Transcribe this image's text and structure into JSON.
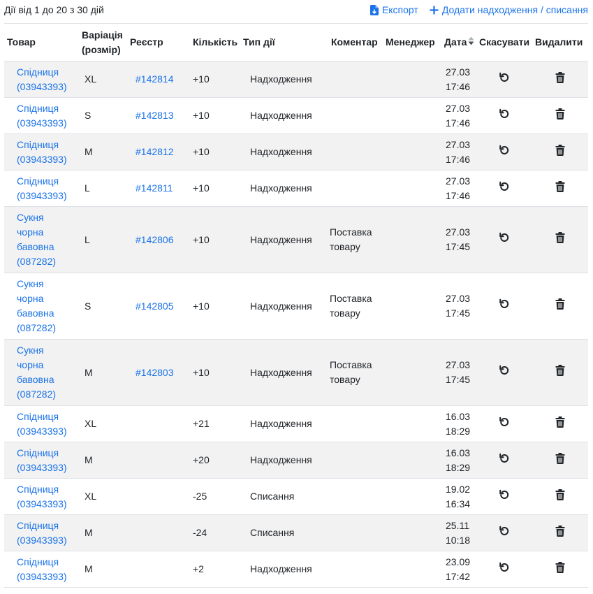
{
  "summary": "Дії від 1 до 20 з 30 дій",
  "toolbar": {
    "export_label": "Експорт",
    "add_label": "Додати надходження / списання"
  },
  "colors": {
    "link": "#1a73e8",
    "stripe": "#f2f2f2",
    "text": "#212529"
  },
  "headers": {
    "product": "Товар",
    "variation": "Варіація (розмір)",
    "registry": "Реєстр",
    "quantity": "Кількість",
    "action_type": "Тип дії",
    "comment": "Коментар",
    "manager": "Менеджер",
    "date": "Дата",
    "undo": "Скасувати",
    "delete": "Видалити"
  },
  "rows": [
    {
      "product_name": "Спідниця",
      "product_code": "(03943393)",
      "variation": "XL",
      "registry": "#142814",
      "quantity": "+10",
      "type": "Надходження",
      "comment": "",
      "manager": "",
      "date": "27.03",
      "time": "17:46"
    },
    {
      "product_name": "Спідниця",
      "product_code": "(03943393)",
      "variation": "S",
      "registry": "#142813",
      "quantity": "+10",
      "type": "Надходження",
      "comment": "",
      "manager": "",
      "date": "27.03",
      "time": "17:46"
    },
    {
      "product_name": "Спідниця",
      "product_code": "(03943393)",
      "variation": "M",
      "registry": "#142812",
      "quantity": "+10",
      "type": "Надходження",
      "comment": "",
      "manager": "",
      "date": "27.03",
      "time": "17:46"
    },
    {
      "product_name": "Спідниця",
      "product_code": "(03943393)",
      "variation": "L",
      "registry": "#142811",
      "quantity": "+10",
      "type": "Надходження",
      "comment": "",
      "manager": "",
      "date": "27.03",
      "time": "17:46"
    },
    {
      "product_name": "Сукня чорна бавовна",
      "product_code": "(087282)",
      "variation": "L",
      "registry": "#142806",
      "quantity": "+10",
      "type": "Надходження",
      "comment": "Поставка товару",
      "manager": "",
      "date": "27.03",
      "time": "17:45"
    },
    {
      "product_name": "Сукня чорна бавовна",
      "product_code": "(087282)",
      "variation": "S",
      "registry": "#142805",
      "quantity": "+10",
      "type": "Надходження",
      "comment": "Поставка товару",
      "manager": "",
      "date": "27.03",
      "time": "17:45"
    },
    {
      "product_name": "Сукня чорна бавовна",
      "product_code": "(087282)",
      "variation": "M",
      "registry": "#142803",
      "quantity": "+10",
      "type": "Надходження",
      "comment": "Поставка товару",
      "manager": "",
      "date": "27.03",
      "time": "17:45"
    },
    {
      "product_name": "Спідниця",
      "product_code": "(03943393)",
      "variation": "XL",
      "registry": "",
      "quantity": "+21",
      "type": "Надходження",
      "comment": "",
      "manager": "",
      "date": "16.03",
      "time": "18:29"
    },
    {
      "product_name": "Спідниця",
      "product_code": "(03943393)",
      "variation": "M",
      "registry": "",
      "quantity": "+20",
      "type": "Надходження",
      "comment": "",
      "manager": "",
      "date": "16.03",
      "time": "18:29"
    },
    {
      "product_name": "Спідниця",
      "product_code": "(03943393)",
      "variation": "XL",
      "registry": "",
      "quantity": "-25",
      "type": "Списання",
      "comment": "",
      "manager": "",
      "date": "19.02",
      "time": "16:34"
    },
    {
      "product_name": "Спідниця",
      "product_code": "(03943393)",
      "variation": "M",
      "registry": "",
      "quantity": "-24",
      "type": "Списання",
      "comment": "",
      "manager": "",
      "date": "25.11",
      "time": "10:18"
    },
    {
      "product_name": "Спідниця",
      "product_code": "(03943393)",
      "variation": "M",
      "registry": "",
      "quantity": "+2",
      "type": "Надходження",
      "comment": "",
      "manager": "",
      "date": "23.09",
      "time": "17:42"
    }
  ]
}
